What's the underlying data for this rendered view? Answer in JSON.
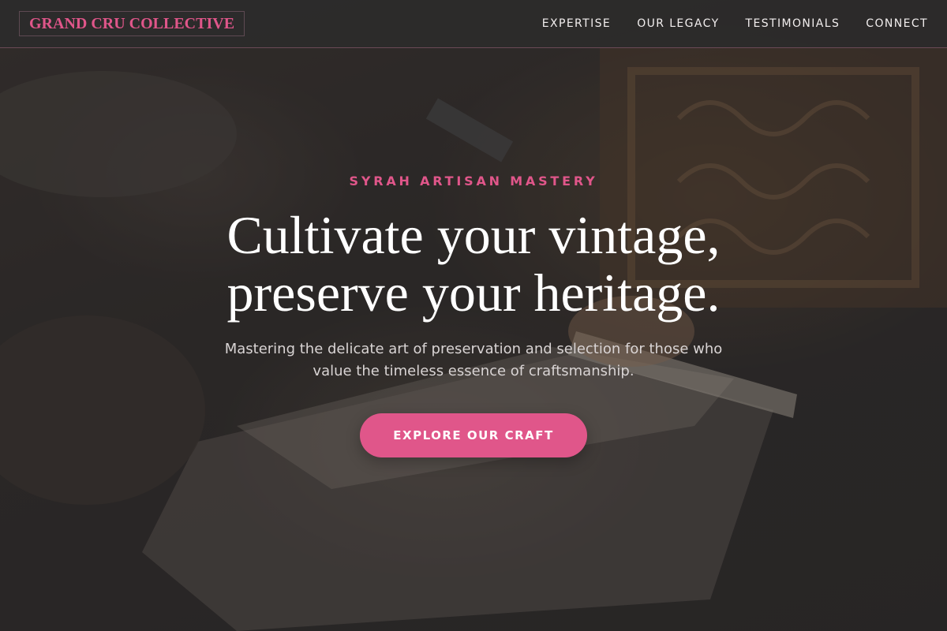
{
  "nav": {
    "brand": "GRAND CRU COLLECTIVE",
    "links": [
      "EXPERTISE",
      "OUR LEGACY",
      "TESTIMONIALS",
      "CONNECT"
    ]
  },
  "hero": {
    "eyebrow": "SYRAH ARTISAN MASTERY",
    "headline_line1": "Cultivate your vintage,",
    "headline_line2": "preserve your heritage.",
    "subtitle": "Mastering the delicate art of preservation and selection for those who value the timeless essence of craftsmanship.",
    "cta_label": "EXPLORE OUR CRAFT",
    "background_image": "artisan-woodcarving-photo"
  },
  "colors": {
    "accent": "#e0568a",
    "nav_background": "#2c2b2b",
    "text_light": "#ffffff"
  }
}
